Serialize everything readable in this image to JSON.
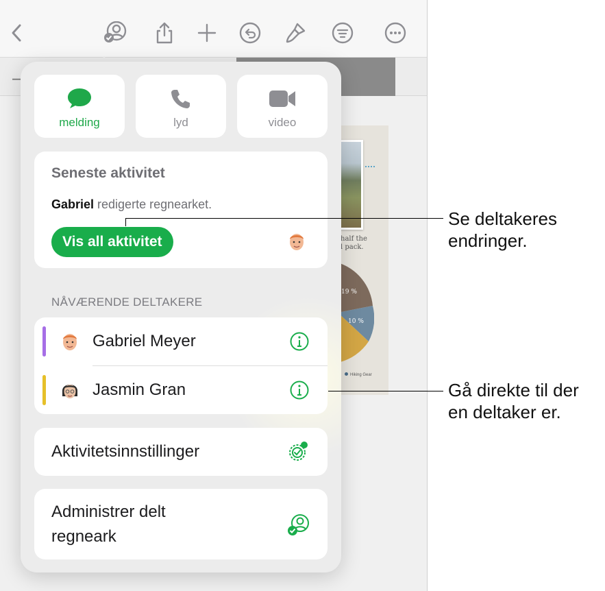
{
  "popover": {
    "comm": {
      "message_label": "melding",
      "audio_label": "lyd",
      "video_label": "video"
    },
    "activity": {
      "title": "Seneste aktivitet",
      "user": "Gabriel",
      "action": " redigerte regnearket.",
      "button_label": "Vis all aktivitet"
    },
    "participants_header": "NÅVÆRENDE DELTAKERE",
    "participants": [
      {
        "name": "Gabriel Meyer",
        "color": "#a66ee6"
      },
      {
        "name": "Jasmin Gran",
        "color": "#e6c029"
      }
    ],
    "settings_label": "Aktivitetsinnstillinger",
    "manage_label_line1": "Administrer delt",
    "manage_label_line2": "regneark"
  },
  "document": {
    "caption_line1": "half the",
    "caption_line2": "l pack.",
    "pie_label_1": "19 %",
    "pie_label_2": "10 %",
    "legend_label": "Hiking Gear"
  },
  "callouts": {
    "top_line1": "Se deltakeres",
    "top_line2": "endringer.",
    "bottom_line1": "Gå direkte til der",
    "bottom_line2": "en deltaker er."
  },
  "colors": {
    "accent_green": "#19ad4b",
    "toolbar_icon": "#8e8e93"
  }
}
